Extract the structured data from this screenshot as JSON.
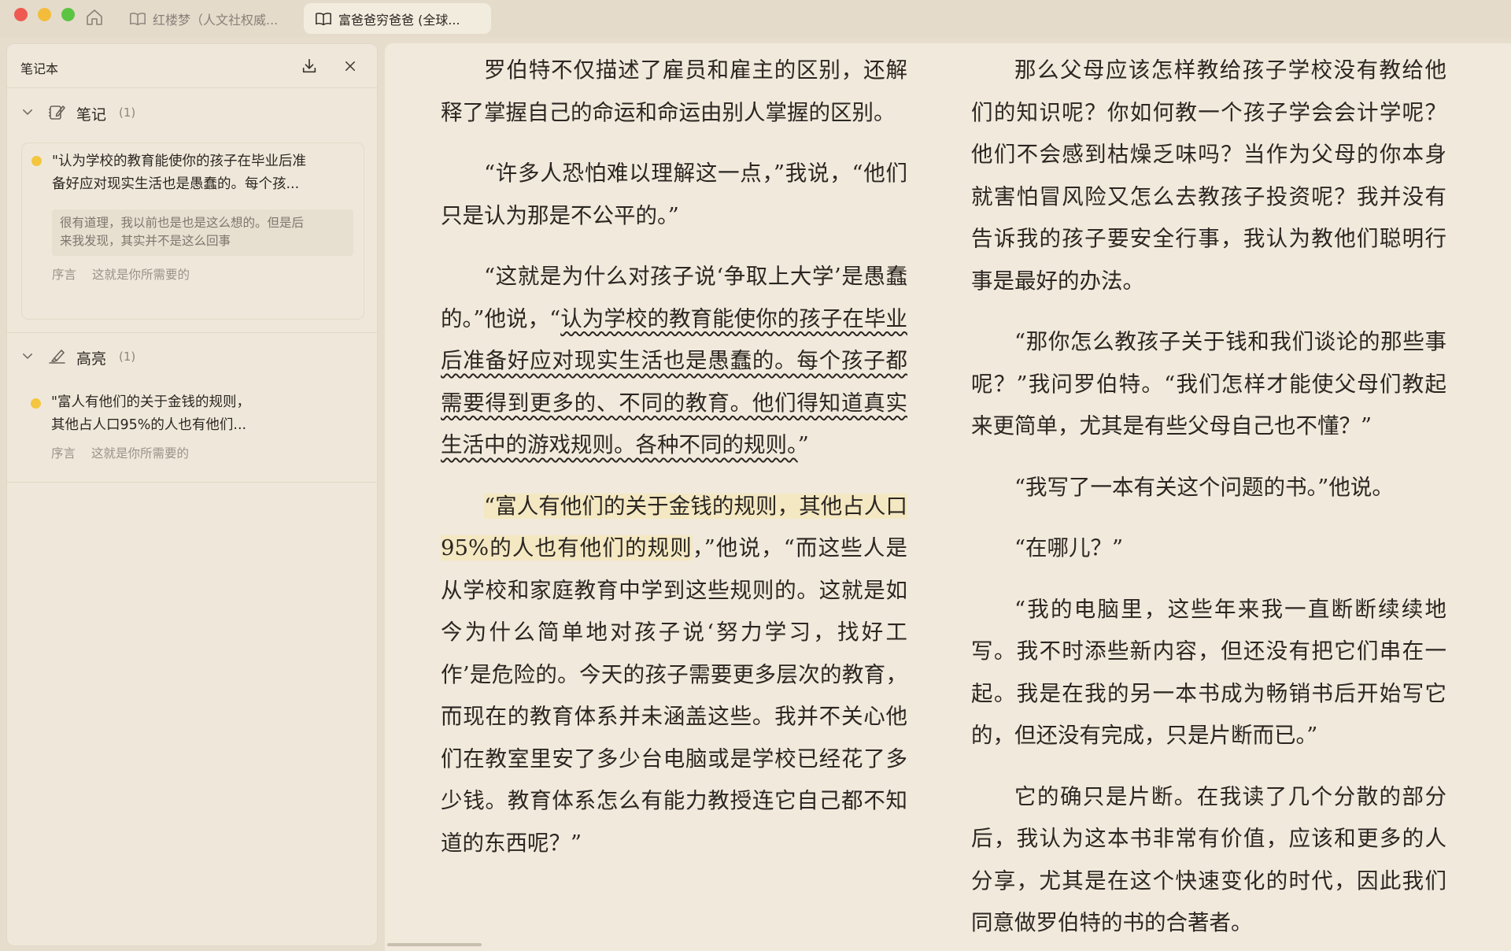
{
  "titlebar": {
    "tabs": [
      {
        "label": "红楼梦（人文社权威...",
        "active": false
      },
      {
        "label": "富爸爸穷爸爸 (全球...",
        "active": true
      }
    ]
  },
  "sidebar": {
    "title": "笔记本",
    "notes_section": {
      "label": "笔记",
      "count": "(1)"
    },
    "note": {
      "quote_line1": "\"认为学校的教育能使你的孩子在毕业后准",
      "quote_line2": "备好应对现实生活也是愚蠢的。每个孩...",
      "comment_line1": "很有道理，我以前也是也是这么想的。但是后",
      "comment_line2": "来我发现，其实并不是这么回事",
      "chapter": "序言",
      "section": "这就是你所需要的"
    },
    "highlights_section": {
      "label": "高亮",
      "count": "(1)"
    },
    "highlight": {
      "quote_line1": "\"富人有他们的关于金钱的规则，",
      "quote_line2": "其他占人口95%的人也有他们...",
      "chapter": "序言",
      "section": "这就是你所需要的"
    }
  },
  "reader": {
    "left": {
      "p1": "罗伯特不仅描述了雇员和雇主的区别，还解释了掌握自己的命运和命运由别人掌握的区别。",
      "p2": "“许多人恐怕难以理解这一点，”我说，“他们只是认为那是不公平的。”",
      "p3_pre": "“这就是为什么对孩子说‘争取上大学’是愚蠢的。”他说，“",
      "p3_underlined": "认为学校的教育能使你的孩子在毕业后准备好应对现实生活也是愚蠢的。每个孩子都需要得到更多的、不同的教育。他们得知道真实生活中的游戏规则。各种不同的规则。",
      "p3_post": "”",
      "p4_highlight": "“富人有他们的关于金钱的规则，其他占人口95%的人也有他们的规则",
      "p4_rest": "，”他说，“而这些人是从学校和家庭教育中学到这些规则的。这就是如今为什么简单地对孩子说‘努力学习，找好工作’是危险的。今天的孩子需要更多层次的教育，而现在的教育体系并未涵盖这些。我并不关心他们在教室里安了多少台电脑或是学校已经花了多少钱。教育体系怎么有能力教授连它自己都不知道的东西呢？”"
    },
    "right": {
      "p1": "那么父母应该怎样教给孩子学校没有教给他们的知识呢？你如何教一个孩子学会会计学呢？他们不会感到枯燥乏味吗？当作为父母的你本身就害怕冒风险又怎么去教孩子投资呢？我并没有告诉我的孩子要安全行事，我认为教他们聪明行事是最好的办法。",
      "p2": "“那你怎么教孩子关于钱和我们谈论的那些事呢？”我问罗伯特。“我们怎样才能使父母们教起来更简单，尤其是有些父母自己也不懂？”",
      "p3": "“我写了一本有关这个问题的书。”他说。",
      "p4": "“在哪儿？”",
      "p5": "“我的电脑里，这些年来我一直断断续续地写。我不时添些新内容，但还没有把它们串在一起。我是在我的另一本书成为畅销书后开始写它的，但还没有完成，只是片断而已。”",
      "p6": "它的确只是片断。在我读了几个分散的部分后，我认为这本书非常有价值，应该和更多的人分享，尤其是在这个快速变化的时代，因此我们同意做罗伯特的书的合著者。"
    }
  },
  "colors": {
    "background": "#e6ddcd",
    "page": "#f1e9db",
    "highlight": "#f4e8c2",
    "dot": "#f4c63f"
  }
}
